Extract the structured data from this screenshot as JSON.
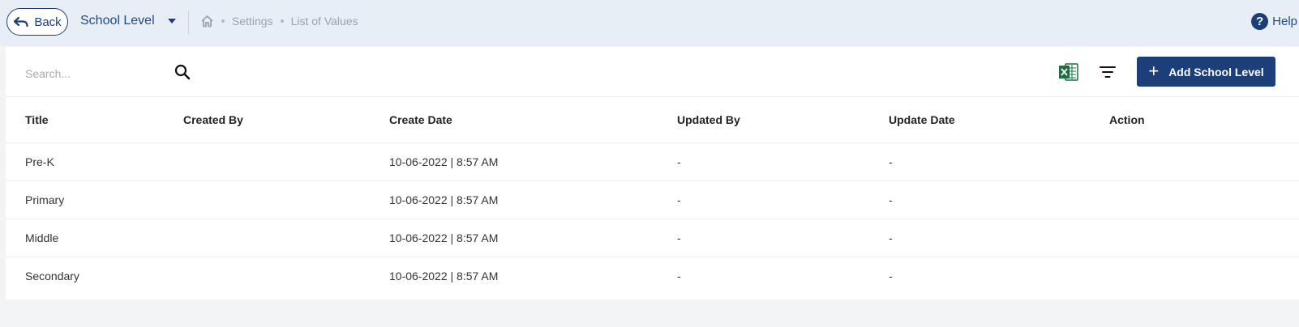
{
  "header": {
    "back_label": "Back",
    "module_title": "School Level",
    "breadcrumb": [
      "Settings",
      "List of Values"
    ],
    "help_label": "Help"
  },
  "toolbar": {
    "search_placeholder": "Search...",
    "add_button_label": "Add School Level"
  },
  "table": {
    "columns": [
      "Title",
      "Created By",
      "Create Date",
      "Updated By",
      "Update Date",
      "Action"
    ],
    "rows": [
      {
        "title": "Pre-K",
        "created_by": "",
        "create_date": "10-06-2022 | 8:57 AM",
        "updated_by": "-",
        "update_date": "-",
        "action": ""
      },
      {
        "title": "Primary",
        "created_by": "",
        "create_date": "10-06-2022 | 8:57 AM",
        "updated_by": "-",
        "update_date": "-",
        "action": ""
      },
      {
        "title": "Middle",
        "created_by": "",
        "create_date": "10-06-2022 | 8:57 AM",
        "updated_by": "-",
        "update_date": "-",
        "action": ""
      },
      {
        "title": "Secondary",
        "created_by": "",
        "create_date": "10-06-2022 | 8:57 AM",
        "updated_by": "-",
        "update_date": "-",
        "action": ""
      }
    ]
  },
  "colors": {
    "primary": "#1c3f7a",
    "header_bg": "#e8eef5",
    "page_bg": "#f3f4f6",
    "excel_green": "#1d6f42"
  },
  "icons": [
    "undo-arrow-icon",
    "caret-down-icon",
    "home-icon",
    "help-icon",
    "search-icon",
    "excel-icon",
    "filter-icon",
    "plus-icon"
  ]
}
